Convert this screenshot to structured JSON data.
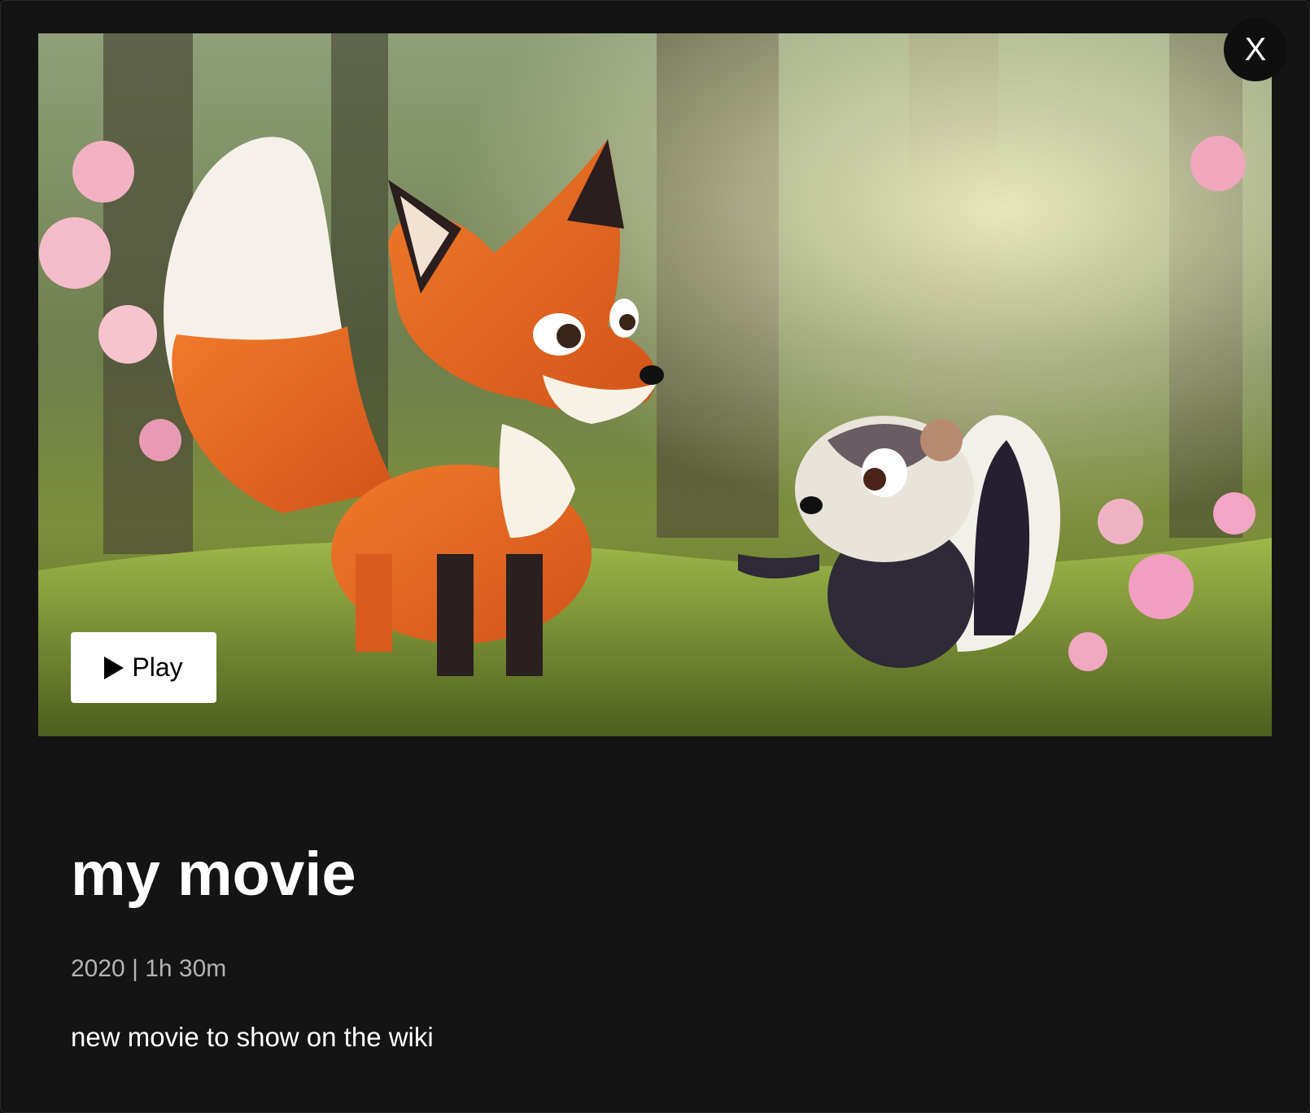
{
  "modal": {
    "close_label": "X",
    "play_label": "Play",
    "title": "my movie",
    "meta": "2020 | 1h 30m",
    "description": "new movie to show on the wiki"
  },
  "icons": {
    "play": "play-icon",
    "close": "close-icon"
  },
  "colors": {
    "background": "#141414",
    "title": "#ffffff",
    "meta": "#b3b3b3",
    "button_bg": "#ffffff",
    "close_bg": "#0f0f0f"
  }
}
